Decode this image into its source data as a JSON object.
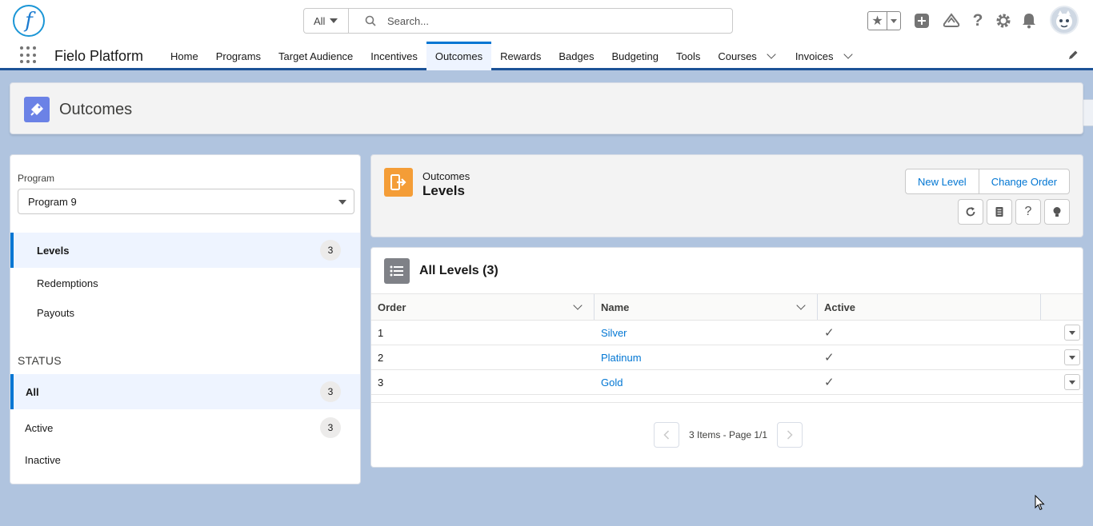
{
  "header": {
    "logo_letter": "f",
    "search": {
      "scope": "All",
      "placeholder": "Search..."
    }
  },
  "nav": {
    "app_name": "Fielo Platform",
    "tabs": [
      {
        "label": "Home",
        "active": false,
        "dropdown": false
      },
      {
        "label": "Programs",
        "active": false,
        "dropdown": false
      },
      {
        "label": "Target Audience",
        "active": false,
        "dropdown": false
      },
      {
        "label": "Incentives",
        "active": false,
        "dropdown": false
      },
      {
        "label": "Outcomes",
        "active": true,
        "dropdown": false
      },
      {
        "label": "Rewards",
        "active": false,
        "dropdown": false
      },
      {
        "label": "Badges",
        "active": false,
        "dropdown": false
      },
      {
        "label": "Budgeting",
        "active": false,
        "dropdown": false
      },
      {
        "label": "Tools",
        "active": false,
        "dropdown": false
      },
      {
        "label": "Courses",
        "active": false,
        "dropdown": true
      },
      {
        "label": "Invoices",
        "active": false,
        "dropdown": true
      }
    ]
  },
  "page_header": {
    "title": "Outcomes"
  },
  "left_panel": {
    "program_label": "Program",
    "program_value": "Program 9",
    "items": [
      {
        "label": "Levels",
        "count": "3",
        "selected": true
      },
      {
        "label": "Redemptions",
        "count": "",
        "selected": false
      },
      {
        "label": "Payouts",
        "count": "",
        "selected": false
      }
    ],
    "status_label": "STATUS",
    "status_items": [
      {
        "label": "All",
        "count": "3",
        "selected": true
      },
      {
        "label": "Active",
        "count": "3",
        "selected": false
      },
      {
        "label": "Inactive",
        "count": "",
        "selected": false
      }
    ]
  },
  "right_header": {
    "subtitle": "Outcomes",
    "title": "Levels",
    "new_level": "New Level",
    "change_order": "Change Order"
  },
  "list": {
    "title": "All Levels (3)",
    "columns": [
      "Order",
      "Name",
      "Active"
    ],
    "rows": [
      {
        "order": "1",
        "name": "Silver",
        "active": "✓"
      },
      {
        "order": "2",
        "name": "Platinum",
        "active": "✓"
      },
      {
        "order": "3",
        "name": "Gold",
        "active": "✓"
      }
    ],
    "pager_text": "3 Items - Page 1/1"
  },
  "colors": {
    "brand_blue": "#0176d3",
    "nav_underline": "#1b5297",
    "outcomes_icon": "#6b82e6",
    "levels_icon": "#f49d37",
    "list_icon": "#7f8187",
    "background": "#b0c4df"
  }
}
